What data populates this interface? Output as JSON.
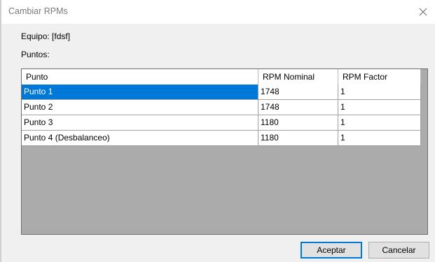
{
  "window": {
    "title": "Cambiar RPMs"
  },
  "labels": {
    "equipo": "Equipo: [fdsf]",
    "puntos": "Puntos:"
  },
  "table": {
    "columns": [
      "Punto",
      "RPM Nominal",
      "RPM Factor"
    ],
    "rows": [
      [
        "Punto 1",
        "1748",
        "1"
      ],
      [
        "Punto 2",
        "1748",
        "1"
      ],
      [
        "Punto 3",
        "1180",
        "1"
      ],
      [
        "Punto 4 (Desbalanceo)",
        "1180",
        "1"
      ]
    ]
  },
  "buttons": {
    "accept": "Aceptar",
    "cancel": "Cancelar"
  },
  "colors": {
    "selection": "#0078d7",
    "grid_background": "#ababab"
  },
  "icons": {
    "close": "close-icon"
  }
}
